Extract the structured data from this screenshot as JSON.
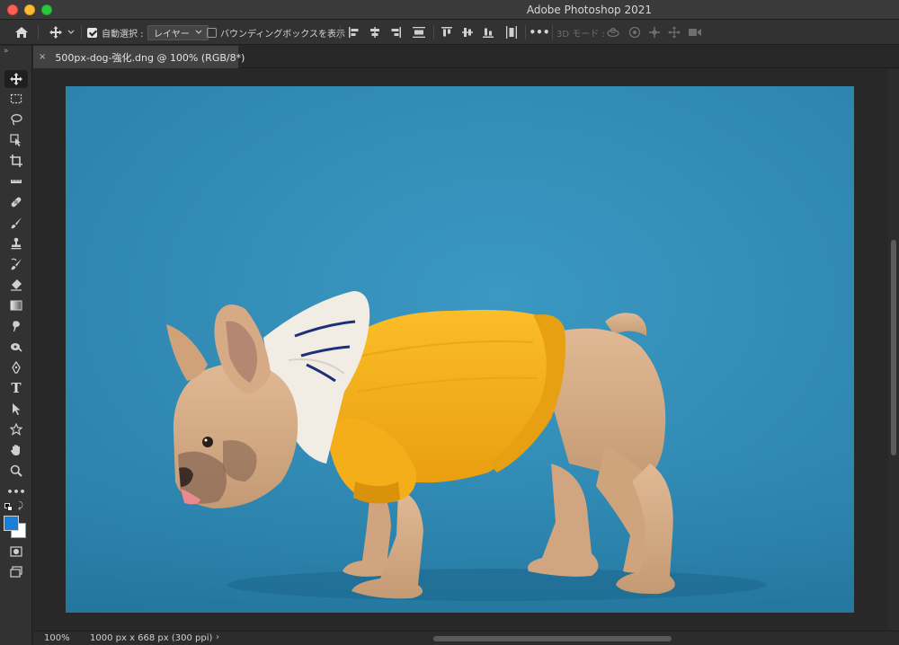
{
  "window": {
    "title": "Adobe Photoshop 2021"
  },
  "options_bar": {
    "auto_select_label": "自動選択 :",
    "auto_select_checked": true,
    "auto_select_target": "レイヤー",
    "show_bounding_box_label": "バウンディングボックスを表示",
    "show_bounding_box_checked": false,
    "mode_3d_label": "3D モード :",
    "more_label": "•••"
  },
  "document": {
    "tab_title": "500px-dog-強化.dng @ 100% (RGB/8*)",
    "close_glyph": "×"
  },
  "toolbar": {
    "collapse_glyph": "»",
    "tools": [
      "move-tool",
      "marquee-tool",
      "lasso-tool",
      "object-selection-tool",
      "crop-tool",
      "eyedropper-tool",
      "healing-brush-tool",
      "brush-tool",
      "clone-stamp-tool",
      "history-brush-tool",
      "eraser-tool",
      "gradient-tool",
      "blur-tool",
      "dodge-tool",
      "pen-tool",
      "type-tool",
      "path-selection-tool",
      "shape-tool",
      "hand-tool",
      "zoom-tool",
      "edit-toolbar"
    ],
    "type_glyph": "T",
    "edit_toolbar_glyph": "•••",
    "foreground_color": "#1a7fd6",
    "background_color": "#ffffff"
  },
  "status": {
    "zoom": "100%",
    "doc_info": "1000 px x 668 px (300 ppi)",
    "arrow_glyph": "›"
  },
  "colors": {
    "photo_background": "#2f8cb4",
    "sweater": "#f6b21a",
    "hood": "#f1ece4",
    "dog_fur": "#d6ad86"
  }
}
